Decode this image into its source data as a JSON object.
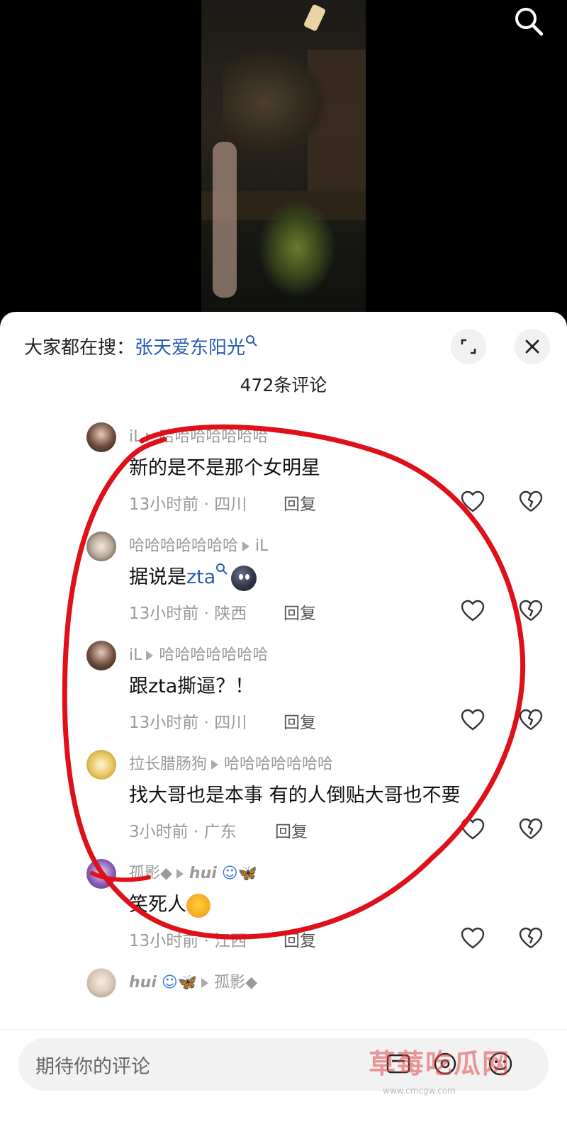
{
  "video": {
    "search_icon": "search-icon"
  },
  "header": {
    "trending_prefix": "大家都在搜：",
    "trending_link": "张天爱东阳光",
    "expand_icon": "expand-icon",
    "close_icon": "close-icon",
    "comment_count": "472条评论"
  },
  "comments": [
    {
      "author": "iL",
      "reply_to": "哈哈哈哈哈哈哈",
      "text": "新的是不是那个女明星",
      "time": "13小时前 · 四川",
      "reply_label": "回复"
    },
    {
      "author": "哈哈哈哈哈哈哈",
      "reply_to": "iL",
      "text_before": "据说是",
      "text_link": "zta",
      "time": "13小时前 · 陕西",
      "reply_label": "回复"
    },
    {
      "author": "iL",
      "reply_to": "哈哈哈哈哈哈哈",
      "text": "跟zta撕逼？！",
      "time": "13小时前 · 四川",
      "reply_label": "回复"
    },
    {
      "author": "拉长腊肠狗",
      "reply_to": "哈哈哈哈哈哈哈",
      "text": "找大哥也是本事 有的人倒贴大哥也不要",
      "time": "3小时前 · 广东",
      "reply_label": "回复"
    },
    {
      "author": "孤影◆",
      "reply_to": "hui",
      "text": "笑死人",
      "time": "13小时前 · 江西",
      "reply_label": "回复"
    },
    {
      "author": "hui",
      "reply_to": "孤影◆"
    }
  ],
  "input": {
    "placeholder": "期待你的评论"
  },
  "watermark": {
    "title": "草莓吃瓜网",
    "url": "www.cmcgw.com"
  },
  "colors": {
    "link": "#2a5bb5",
    "annotation": "#e0101a",
    "meta": "#9a9a9a"
  }
}
